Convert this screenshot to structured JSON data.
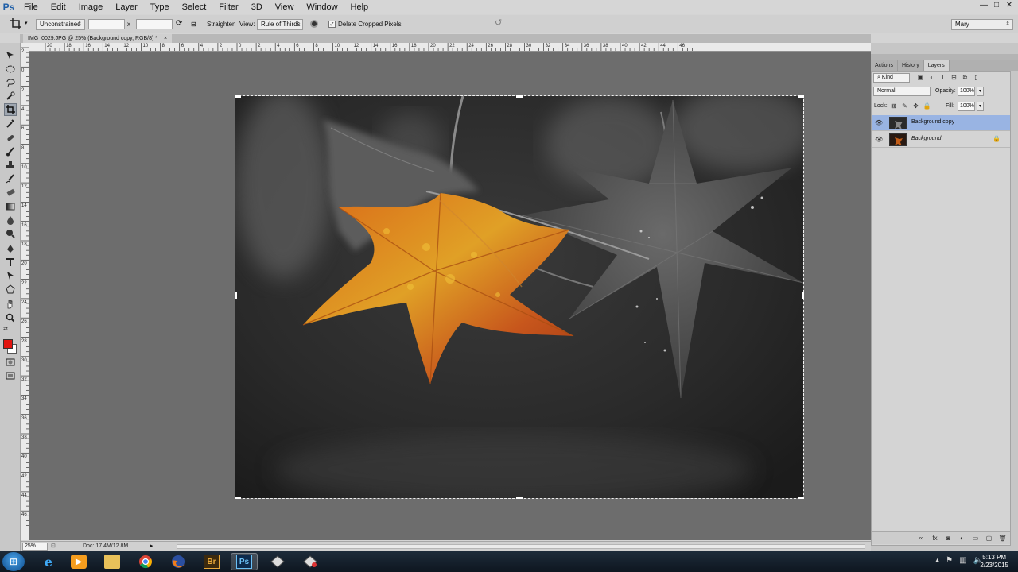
{
  "app": {
    "logo": "Ps"
  },
  "menu": [
    "File",
    "Edit",
    "Image",
    "Layer",
    "Type",
    "Select",
    "Filter",
    "3D",
    "View",
    "Window",
    "Help"
  ],
  "window_controls": {
    "minimize": "—",
    "maximize": "□",
    "close": "✕"
  },
  "options_bar": {
    "ratio_select": "Unconstrained",
    "swap_symbol": "x",
    "straighten_label": "Straighten",
    "view_label": "View:",
    "view_select": "Rule of Thirds",
    "delete_cropped_label": "Delete Cropped Pixels",
    "delete_cropped_checked": true,
    "workspace_select": "Mary"
  },
  "document": {
    "tab_title": "IMG_0029.JPG @ 25% (Background copy, RGB/8) *",
    "tab_close": "×"
  },
  "ruler": {
    "h_labels": [
      "20",
      "18",
      "16",
      "14",
      "12",
      "10",
      "8",
      "6",
      "4",
      "2",
      "0",
      "2",
      "4",
      "6",
      "8",
      "10",
      "12",
      "14",
      "16",
      "18",
      "20",
      "22",
      "24",
      "26",
      "28",
      "30",
      "32",
      "34",
      "36",
      "38",
      "40",
      "42",
      "44",
      "46"
    ],
    "v_labels": [
      "2",
      "0",
      "2",
      "4",
      "6",
      "8",
      "10",
      "12",
      "14",
      "16",
      "18",
      "20",
      "22",
      "24",
      "26",
      "28",
      "30",
      "32",
      "34",
      "36",
      "38",
      "40",
      "42",
      "44",
      "46"
    ]
  },
  "status": {
    "zoom": "25%",
    "doc_info": "Doc: 17.4M/12.8M"
  },
  "panels": {
    "tabs": [
      "Actions",
      "History",
      "Layers"
    ],
    "active_tab": "Layers",
    "filter_kind": "Kind",
    "blend_mode": "Normal",
    "opacity_label": "Opacity:",
    "opacity_value": "100%",
    "lock_label": "Lock:",
    "fill_label": "Fill:",
    "fill_value": "100%",
    "layers": [
      {
        "name": "Background copy",
        "selected": true,
        "locked": false
      },
      {
        "name": "Background",
        "selected": false,
        "locked": true
      }
    ]
  },
  "taskbar": {
    "apps": [
      "internet-explorer",
      "media-player",
      "file-explorer",
      "chrome",
      "firefox",
      "bridge",
      "photoshop",
      "app-generic-1",
      "app-generic-2"
    ],
    "bridge_label": "Br",
    "photoshop_label": "Ps",
    "clock_time": "5:13 PM",
    "clock_date": "2/23/2015"
  },
  "colors": {
    "foreground_swatch": "#e0140f",
    "background_swatch": "#ffffff",
    "selected_layer": "#99b4e3",
    "canvas_bg": "#6d6d6d"
  }
}
